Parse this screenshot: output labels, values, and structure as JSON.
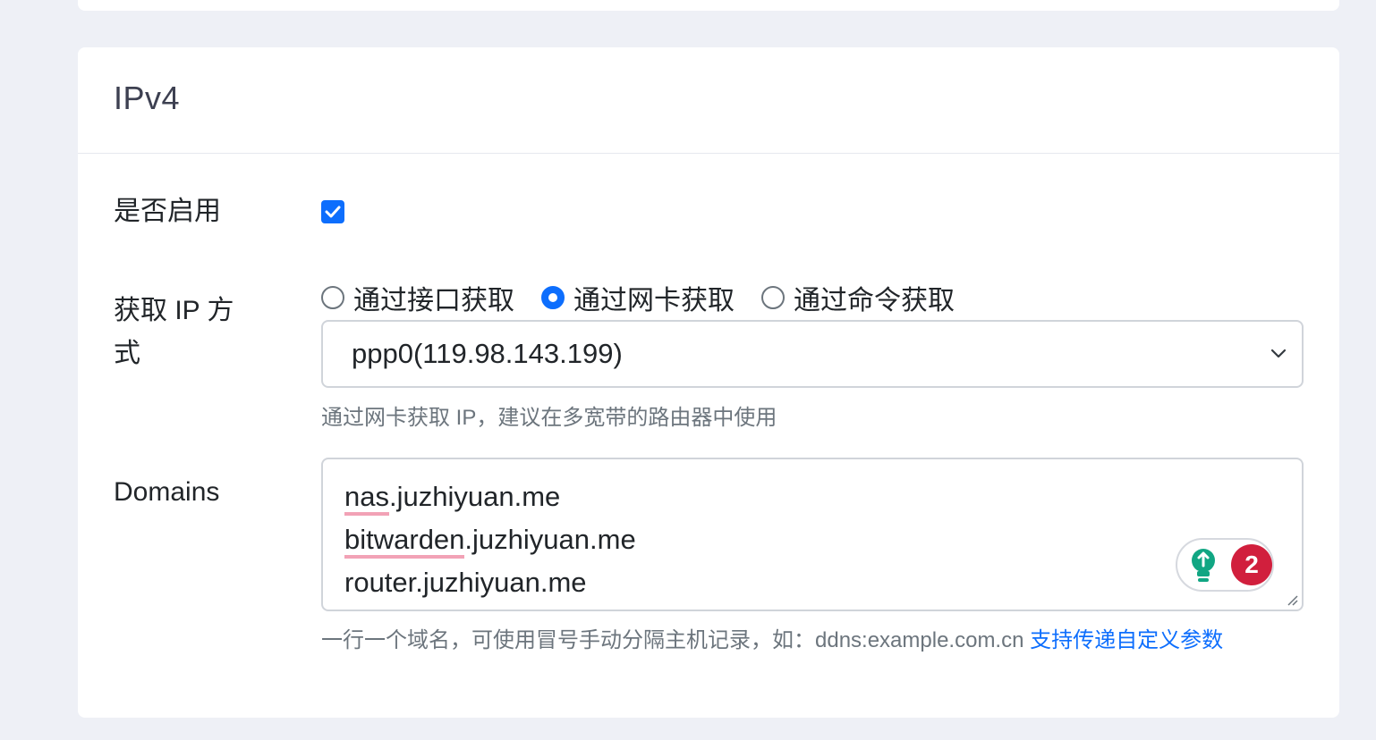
{
  "section": {
    "title": "IPv4"
  },
  "enable": {
    "label": "是否启用",
    "checked": true
  },
  "ip_method": {
    "label_line1": "获取 IP 方",
    "label_line2": "式",
    "options": [
      {
        "label": "通过接口获取",
        "checked": false
      },
      {
        "label": "通过网卡获取",
        "checked": true
      },
      {
        "label": "通过命令获取",
        "checked": false
      }
    ],
    "selected_interface": "ppp0(119.98.143.199)",
    "help": "通过网卡获取 IP，建议在多宽带的路由器中使用"
  },
  "domains": {
    "label": "Domains",
    "lines": [
      {
        "underlined": "nas",
        "rest": ".juzhiyuan.me"
      },
      {
        "underlined": "bitwarden",
        "rest": ".juzhiyuan.me"
      },
      {
        "underlined": "",
        "rest": "router.juzhiyuan.me"
      }
    ],
    "help": "一行一个域名，可使用冒号手动分隔主机记录，如：ddns:example.com.cn ",
    "help_link": "支持传递自定义参数",
    "grammar_count": "2"
  },
  "colors": {
    "accent": "#0d6efd",
    "badge": "#d11f3d",
    "squiggle": "#f2a2b6",
    "bulb": "#11a683"
  }
}
